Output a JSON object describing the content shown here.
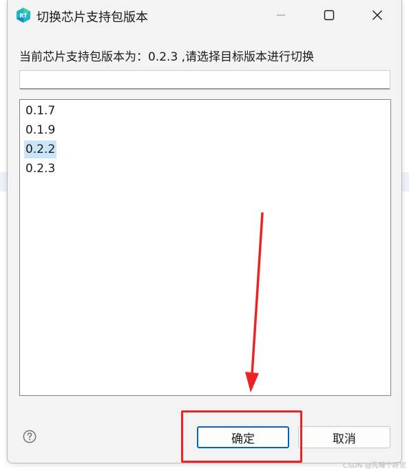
{
  "window": {
    "title": "切换芯片支持包版本",
    "app_icon_label": "RT"
  },
  "prompt": "当前芯片支持包版本为：0.2.3 ,请选择目标版本进行切换",
  "filter": {
    "value": "",
    "placeholder": ""
  },
  "versions": [
    {
      "label": "0.1.7",
      "selected": false
    },
    {
      "label": "0.1.9",
      "selected": false
    },
    {
      "label": "0.2.2",
      "selected": true
    },
    {
      "label": "0.2.3",
      "selected": false
    }
  ],
  "buttons": {
    "ok_label": "确定",
    "cancel_label": "取消"
  },
  "watermark": "CSDN @先睡个好觉",
  "colors": {
    "accent": "#0067c0",
    "selection": "#cce4f7",
    "annotation": "#ee2222"
  },
  "icons": [
    "rt-logo-icon",
    "minimize-icon",
    "maximize-icon",
    "close-icon",
    "help-icon",
    "arrow-annotation"
  ]
}
